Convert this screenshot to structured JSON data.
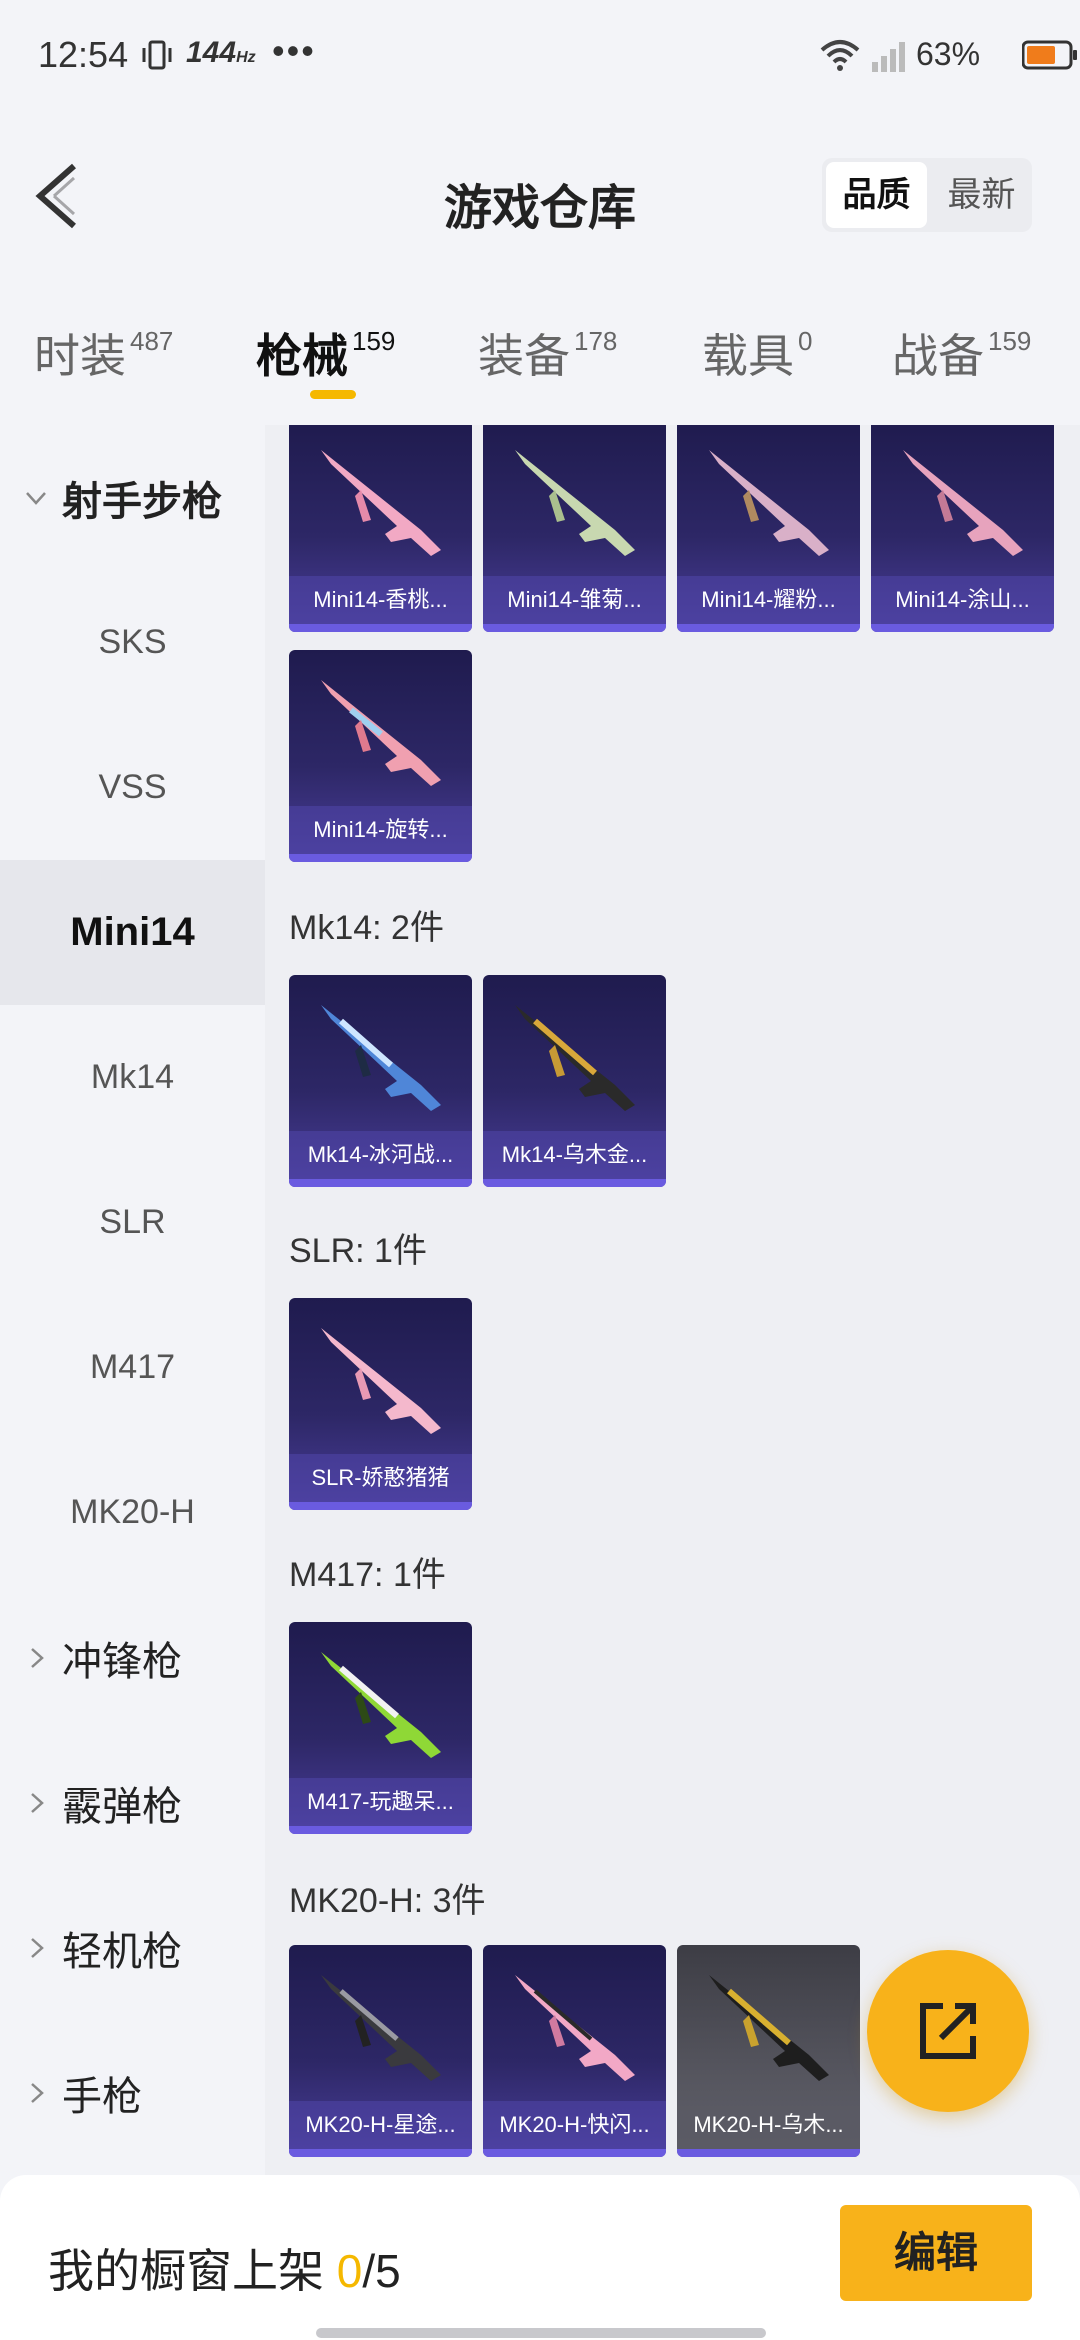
{
  "status": {
    "time": "12:54",
    "refresh_rate": "144",
    "refresh_unit": "Hz",
    "more": "•••",
    "battery": "63%"
  },
  "header": {
    "title": "游戏仓库",
    "sort_options": [
      "品质",
      "最新"
    ]
  },
  "tabs": [
    {
      "label": "时装",
      "count": "487"
    },
    {
      "label": "枪械",
      "count": "159"
    },
    {
      "label": "装备",
      "count": "178"
    },
    {
      "label": "载具",
      "count": "0"
    },
    {
      "label": "战备",
      "count": "159"
    }
  ],
  "sidebar": {
    "group_open": "射手步枪",
    "items": [
      "SKS",
      "VSS",
      "Mini14",
      "Mk14",
      "SLR",
      "M417",
      "MK20-H"
    ],
    "groups": [
      "冲锋枪",
      "霰弹枪",
      "轻机枪",
      "手枪"
    ]
  },
  "sections": [
    {
      "title": "",
      "items": [
        "Mini14-香桃...",
        "Mini14-雏菊...",
        "Mini14-耀粉...",
        "Mini14-涂山...",
        "Mini14-旋转..."
      ]
    },
    {
      "title": "Mk14: 2件",
      "items": [
        "Mk14-冰河战...",
        "Mk14-乌木金..."
      ]
    },
    {
      "title": "SLR: 1件",
      "items": [
        "SLR-娇憨猪猪"
      ]
    },
    {
      "title": "M417: 1件",
      "items": [
        "M417-玩趣呆..."
      ]
    },
    {
      "title": "MK20-H: 3件",
      "items": [
        "MK20-H-星途...",
        "MK20-H-快闪...",
        "MK20-H-乌木..."
      ]
    }
  ],
  "footer": {
    "prefix": "我的橱窗上架 ",
    "count": "0",
    "total": "/5",
    "edit_label": "编辑"
  },
  "colors": {
    "accent": "#f8b21a",
    "card_top": "#1f1b4e",
    "card_bottom": "#4a3e9a"
  }
}
